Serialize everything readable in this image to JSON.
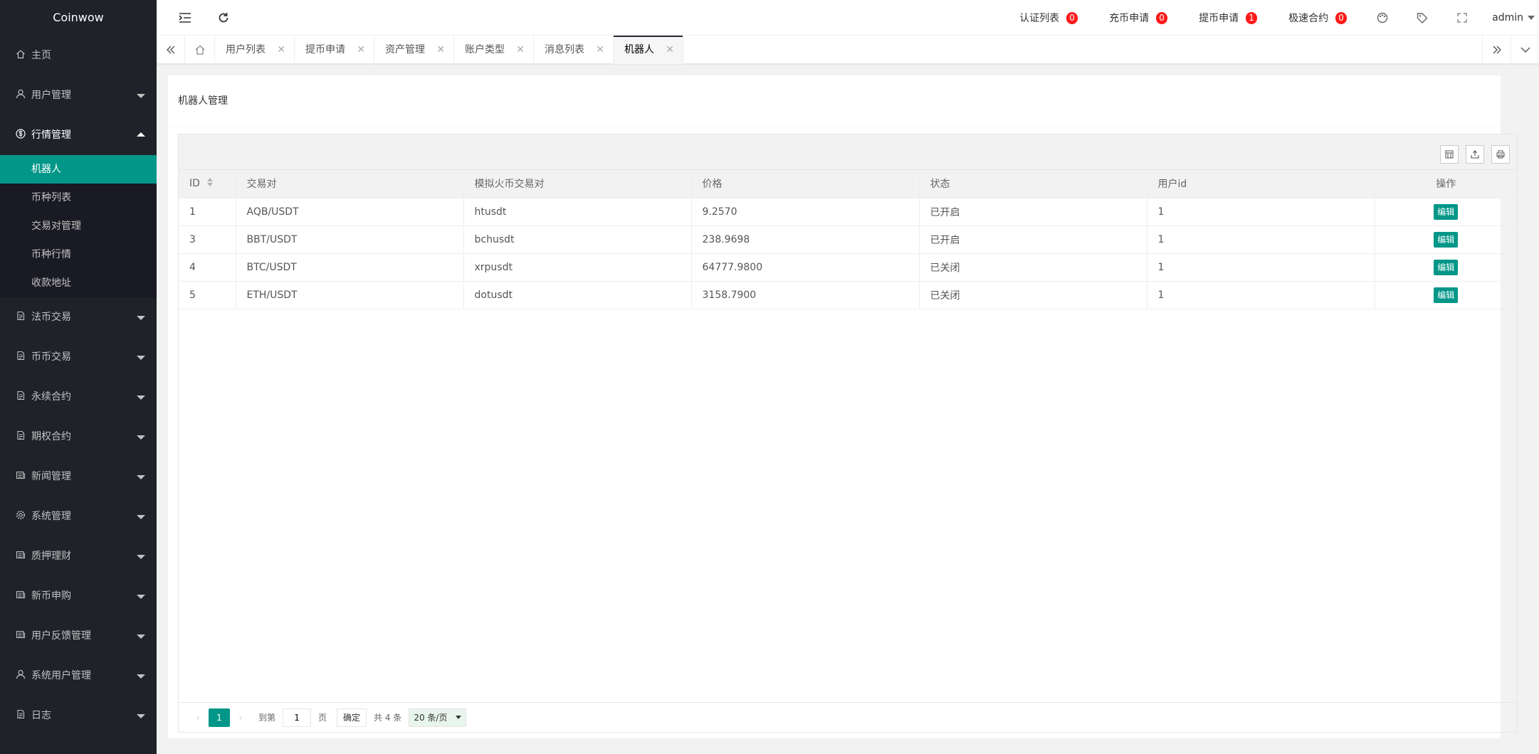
{
  "app": {
    "title": "Coinwow"
  },
  "sidebar": {
    "items": [
      {
        "label": "主页",
        "icon": "home-icon"
      },
      {
        "label": "用户管理",
        "icon": "user-icon"
      },
      {
        "label": "行情管理",
        "icon": "dollar-icon",
        "open": true,
        "children": [
          {
            "label": "机器人",
            "active": true
          },
          {
            "label": "币种列表"
          },
          {
            "label": "交易对管理"
          },
          {
            "label": "币种行情"
          },
          {
            "label": "收款地址"
          }
        ]
      },
      {
        "label": "法币交易",
        "icon": "doc-icon"
      },
      {
        "label": "币币交易",
        "icon": "doc-icon"
      },
      {
        "label": "永续合约",
        "icon": "doc-icon"
      },
      {
        "label": "期权合约",
        "icon": "doc-icon"
      },
      {
        "label": "新闻管理",
        "icon": "news-icon"
      },
      {
        "label": "系统管理",
        "icon": "gear-icon"
      },
      {
        "label": "质押理财",
        "icon": "news-icon"
      },
      {
        "label": "新币申购",
        "icon": "news-icon"
      },
      {
        "label": "用户反馈管理",
        "icon": "news-icon"
      },
      {
        "label": "系统用户管理",
        "icon": "user-icon"
      },
      {
        "label": "日志",
        "icon": "doc-icon"
      }
    ]
  },
  "header": {
    "links": [
      {
        "label": "认证列表",
        "badge": "0"
      },
      {
        "label": "充币申请",
        "badge": "0"
      },
      {
        "label": "提币申请",
        "badge": "1"
      },
      {
        "label": "极速合约",
        "badge": "0"
      }
    ],
    "user": "admin"
  },
  "tabs": [
    {
      "label": "用户列表"
    },
    {
      "label": "提币申请"
    },
    {
      "label": "资产管理"
    },
    {
      "label": "账户类型"
    },
    {
      "label": "消息列表"
    },
    {
      "label": "机器人",
      "active": true
    }
  ],
  "page": {
    "title": "机器人管理"
  },
  "table": {
    "columns": [
      "ID",
      "交易对",
      "模拟火币交易对",
      "价格",
      "状态",
      "用户id",
      "操作"
    ],
    "rows": [
      {
        "id": "1",
        "pair": "AQB/USDT",
        "sim": "htusdt",
        "price": "9.2570",
        "status": "已开启",
        "uid": "1"
      },
      {
        "id": "3",
        "pair": "BBT/USDT",
        "sim": "bchusdt",
        "price": "238.9698",
        "status": "已开启",
        "uid": "1"
      },
      {
        "id": "4",
        "pair": "BTC/USDT",
        "sim": "xrpusdt",
        "price": "64777.9800",
        "status": "已关闭",
        "uid": "1"
      },
      {
        "id": "5",
        "pair": "ETH/USDT",
        "sim": "dotusdt",
        "price": "3158.7900",
        "status": "已关闭",
        "uid": "1"
      }
    ],
    "edit_label": "编辑"
  },
  "pager": {
    "current": "1",
    "goto_label": "到第",
    "goto_value": "1",
    "page_unit": "页",
    "confirm_label": "确定",
    "total_label": "共 4 条",
    "page_size": "20 条/页"
  },
  "colors": {
    "accent": "#009688",
    "sidebar_bg": "#20222a",
    "badge": "#ff1a1a"
  }
}
